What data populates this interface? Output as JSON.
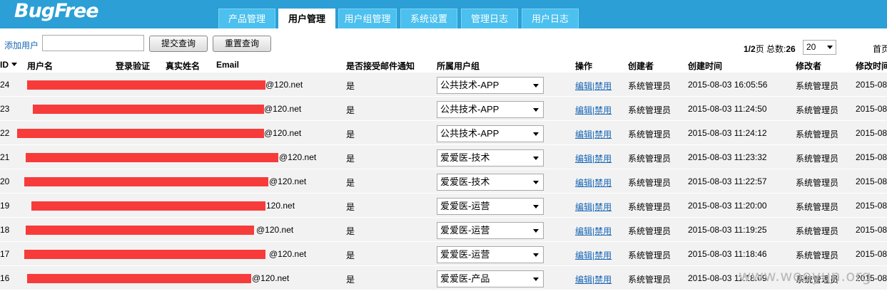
{
  "header": {
    "logo": "BugFree",
    "tabs": [
      {
        "label": "产品管理",
        "active": false
      },
      {
        "label": "用户管理",
        "active": true
      },
      {
        "label": "用户组管理",
        "active": false
      },
      {
        "label": "系统设置",
        "active": false
      },
      {
        "label": "管理日志",
        "active": false
      },
      {
        "label": "用户日志",
        "active": false
      }
    ]
  },
  "toolbar": {
    "add_user": "添加用户",
    "search_value": "",
    "submit_label": "提交查询",
    "reset_label": "重置查询",
    "pager_pages": "1/2",
    "pager_page_suffix": "页 总数:",
    "pager_total": "26",
    "page_size": "20",
    "first_page": "首页"
  },
  "table": {
    "headers": {
      "id": "ID",
      "username": "用户名",
      "login_auth": "登录验证",
      "realname": "真实姓名",
      "email": "Email",
      "notify": "是否接受邮件通知",
      "group": "所属用户组",
      "op": "操作",
      "creator": "创建者",
      "created": "创建时间",
      "modifier": "修改者",
      "modified": "修改时间"
    },
    "rows": [
      {
        "id": "24",
        "email_suffix": "@120.net",
        "notify": "是",
        "group": "公共技术-APP",
        "edit": "编辑",
        "disable": "禁用",
        "creator": "系统管理员",
        "created": "2015-08-03 16:05:56",
        "modifier": "系统管理员",
        "modified": "2015-08"
      },
      {
        "id": "23",
        "email_suffix": "@120.net",
        "notify": "是",
        "group": "公共技术-APP",
        "edit": "编辑",
        "disable": "禁用",
        "creator": "系统管理员",
        "created": "2015-08-03 11:24:50",
        "modifier": "系统管理员",
        "modified": "2015-08"
      },
      {
        "id": "22",
        "email_suffix": "@120.net",
        "notify": "是",
        "group": "公共技术-APP",
        "edit": "编辑",
        "disable": "禁用",
        "creator": "系统管理员",
        "created": "2015-08-03 11:24:12",
        "modifier": "系统管理员",
        "modified": "2015-08"
      },
      {
        "id": "21",
        "email_suffix": "@120.net",
        "notify": "是",
        "group": "爱爱医-技术",
        "edit": "编辑",
        "disable": "禁用",
        "creator": "系统管理员",
        "created": "2015-08-03 11:23:32",
        "modifier": "系统管理员",
        "modified": "2015-08"
      },
      {
        "id": "20",
        "email_suffix": "@120.net",
        "notify": "是",
        "group": "爱爱医-技术",
        "edit": "编辑",
        "disable": "禁用",
        "creator": "系统管理员",
        "created": "2015-08-03 11:22:57",
        "modifier": "系统管理员",
        "modified": "2015-08"
      },
      {
        "id": "19",
        "email_suffix": "120.net",
        "notify": "是",
        "group": "爱爱医-运营",
        "edit": "编辑",
        "disable": "禁用",
        "creator": "系统管理员",
        "created": "2015-08-03 11:20:00",
        "modifier": "系统管理员",
        "modified": "2015-08"
      },
      {
        "id": "18",
        "email_suffix": "@120.net",
        "notify": "是",
        "group": "爱爱医-运营",
        "edit": "编辑",
        "disable": "禁用",
        "creator": "系统管理员",
        "created": "2015-08-03 11:19:25",
        "modifier": "系统管理员",
        "modified": "2015-08"
      },
      {
        "id": "17",
        "email_suffix": "@120.net",
        "notify": "是",
        "group": "爱爱医-运营",
        "edit": "编辑",
        "disable": "禁用",
        "creator": "系统管理员",
        "created": "2015-08-03 11:18:46",
        "modifier": "系统管理员",
        "modified": "2015-08"
      },
      {
        "id": "16",
        "email_suffix": "@120.net",
        "notify": "是",
        "group": "爱爱医-产品",
        "edit": "编辑",
        "disable": "禁用",
        "creator": "系统管理员",
        "created": "2015-08-03 11:18:09",
        "modifier": "系统管理员",
        "modified": "2015-08"
      }
    ]
  },
  "watermark": "www.wooyun.org",
  "colors": {
    "header": "#2b9fd6",
    "tab": "#4cc0ee",
    "redaction": "#f73b3b",
    "link": "#1766b5",
    "row": "#f2f2f2"
  }
}
